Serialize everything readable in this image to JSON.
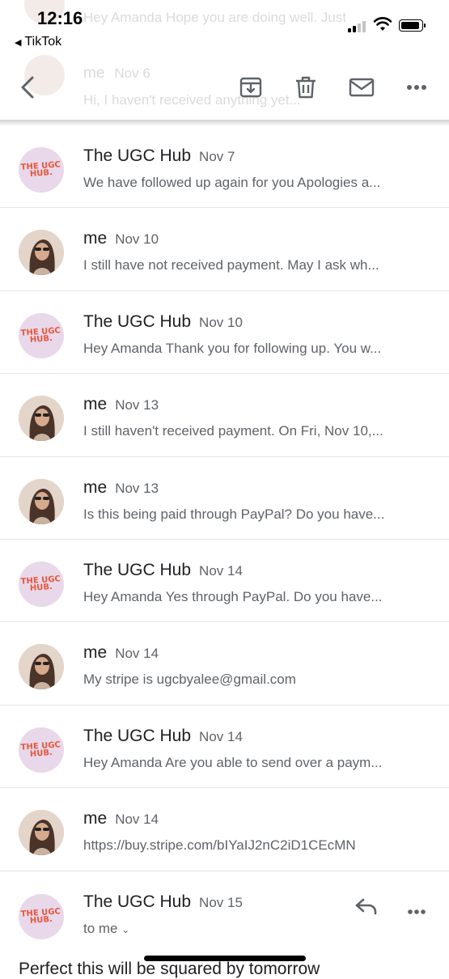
{
  "status": {
    "time": "12:16",
    "back_app": "TikTok"
  },
  "ghost": {
    "top_snippet": "Hey Amanda Hope you are doing well. Just",
    "sender": "me",
    "date": "Nov 6",
    "snippet": "Hi, I haven't received anything yet..."
  },
  "toolbar": {
    "icons": [
      "back-arrow-icon",
      "archive-icon",
      "trash-icon",
      "mail-icon",
      "more-icon"
    ]
  },
  "messages": [
    {
      "sender": "The UGC Hub",
      "date": "Nov 7",
      "snippet": "We have followed up again for you Apologies a...",
      "avatar": "ugc"
    },
    {
      "sender": "me",
      "date": "Nov 10",
      "snippet": "I still have not received payment. May I ask wh...",
      "avatar": "me"
    },
    {
      "sender": "The UGC Hub",
      "date": "Nov 10",
      "snippet": "Hey Amanda Thank you for following up. You w...",
      "avatar": "ugc"
    },
    {
      "sender": "me",
      "date": "Nov 13",
      "snippet": "I still haven't received payment. On Fri, Nov 10,...",
      "avatar": "me"
    },
    {
      "sender": "me",
      "date": "Nov 13",
      "snippet": "Is this being paid through PayPal? Do you have...",
      "avatar": "me"
    },
    {
      "sender": "The UGC Hub",
      "date": "Nov 14",
      "snippet": "Hey Amanda Yes through PayPal. Do you have...",
      "avatar": "ugc"
    },
    {
      "sender": "me",
      "date": "Nov 14",
      "snippet": "My stripe is ugcbyalee@gmail.com",
      "avatar": "me"
    },
    {
      "sender": "The UGC Hub",
      "date": "Nov 14",
      "snippet": "Hey Amanda Are you able to send over a paym...",
      "avatar": "ugc"
    },
    {
      "sender": "me",
      "date": "Nov 14",
      "snippet": "https://buy.stripe.com/bIYaIJ2nC2iD1CEcMN",
      "avatar": "me"
    }
  ],
  "expanded": {
    "sender": "The UGC Hub",
    "date": "Nov 15",
    "recipient": "to me",
    "body": "Perfect this will be squared by tomorrow"
  },
  "ugc_logo_text": "THE UGC HUB",
  "colors": {
    "ugc_avatar_bg": "#e8d8ea",
    "ugc_logo": "#e8563c",
    "secondary_text": "#5f6368"
  }
}
